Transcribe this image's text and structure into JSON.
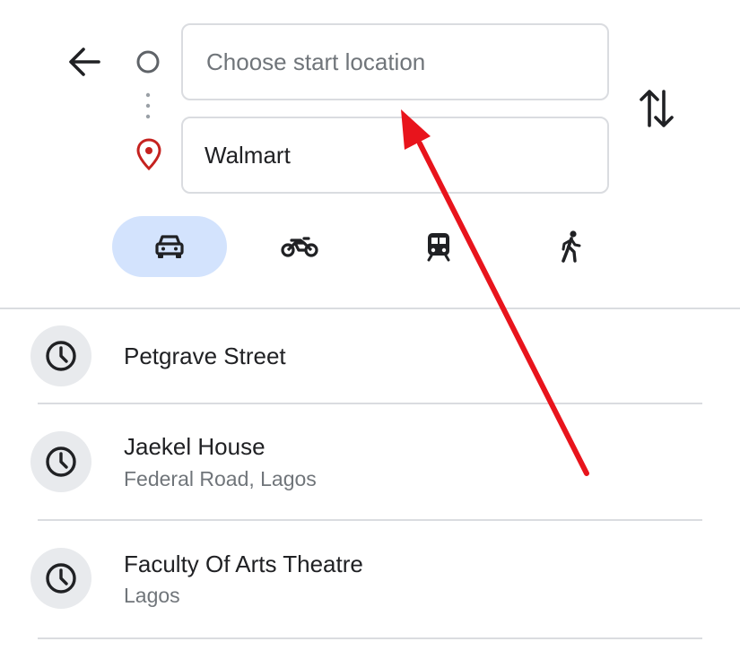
{
  "search": {
    "start_placeholder": "Choose start location",
    "destination_value": "Walmart"
  },
  "icons": {
    "back": "arrow-left-icon",
    "origin": "origin-circle-icon",
    "destination": "location-pin-icon",
    "swap": "swap-vertical-icon",
    "history": "clock-icon"
  },
  "travel_modes": [
    {
      "name": "Driving",
      "icon": "car-icon",
      "selected": true
    },
    {
      "name": "Two-wheeler",
      "icon": "motorcycle-icon",
      "selected": false
    },
    {
      "name": "Transit",
      "icon": "train-icon",
      "selected": false
    },
    {
      "name": "Walking",
      "icon": "walking-icon",
      "selected": false
    }
  ],
  "recent": [
    {
      "title": "Petgrave Street",
      "subtitle": ""
    },
    {
      "title": "Jaekel House",
      "subtitle": "Federal Road, Lagos"
    },
    {
      "title": "Faculty Of Arts Theatre",
      "subtitle": "Lagos"
    }
  ],
  "colors": {
    "active_mode_bg": "#d3e3fd",
    "pin_red": "#c5221f",
    "annotation_arrow": "#e8141c",
    "divider": "#dadce0"
  }
}
